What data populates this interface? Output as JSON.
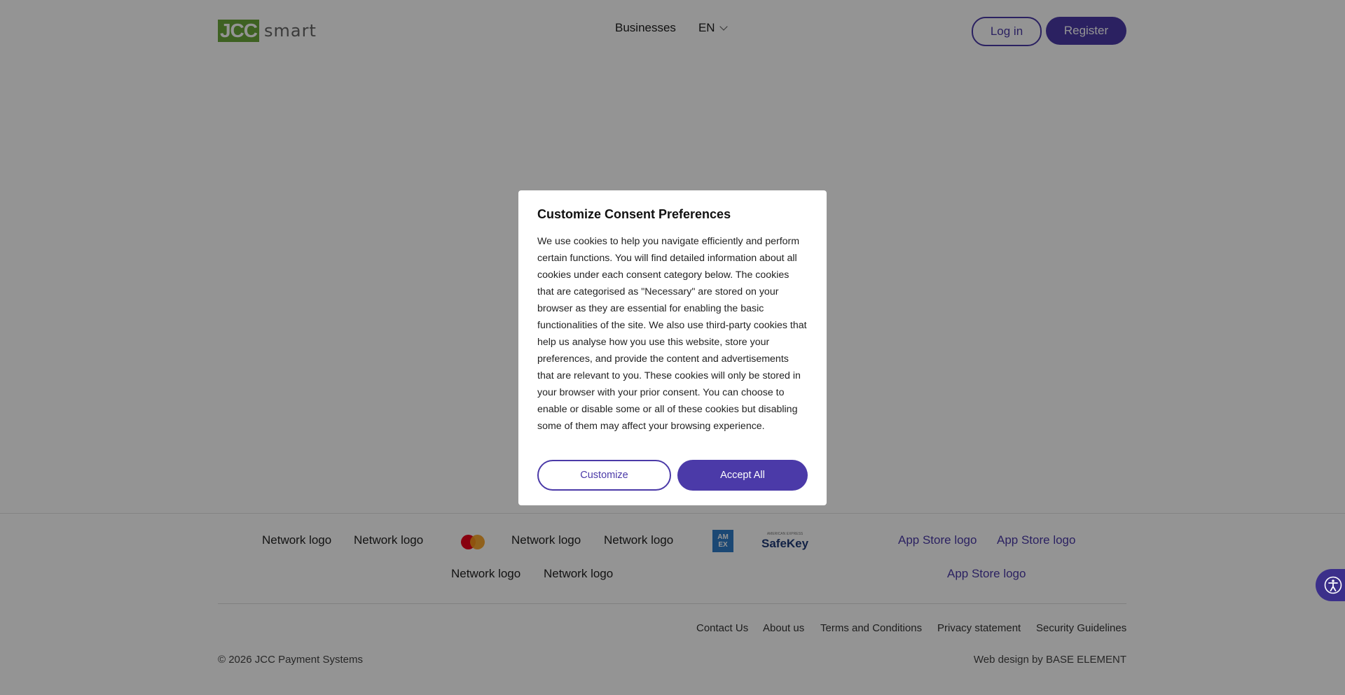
{
  "header": {
    "logo_mark": "JCC",
    "logo_word": "smart",
    "nav_businesses": "Businesses",
    "language": "EN",
    "login_label": "Log in",
    "register_label": "Register"
  },
  "footer": {
    "network_logos_row1": [
      "Network logo",
      "Network logo",
      "Network logo",
      "Network logo"
    ],
    "network_logos_row2": [
      "Network logo",
      "Network logo"
    ],
    "amex_text": "AM EX",
    "safekey_text": "SafeKey",
    "safekey_small": "AMERICAN EXPRESS",
    "app_store_logos": [
      "App Store logo",
      "App Store logo",
      "App Store logo"
    ],
    "links": [
      "Contact Us",
      "About us",
      "Terms and Conditions",
      "Privacy statement",
      "Security Guidelines"
    ],
    "copyright": "© 2026 JCC Payment Systems",
    "webdesign": "Web design by BASE ELEMENT"
  },
  "consent": {
    "title": "Customize Consent Preferences",
    "body": "We use cookies to help you navigate efficiently and perform certain functions. You will find detailed information about all cookies under each consent category below. The cookies that are categorised as \"Necessary\" are stored on your browser as they are essential for enabling the basic functionalities of the site. We also use third-party cookies that help us analyse how you use this website, store your preferences, and provide the content and advertisements that are relevant to you. These cookies will only be stored in your browser with your prior consent. You can choose to enable or disable some or all of these cookies but disabling some of them may affect your browsing experience.",
    "customize_label": "Customize",
    "accept_label": "Accept All"
  },
  "colors": {
    "accent": "#4b3aa8",
    "logo_green": "#6ca83b",
    "overlay": "rgba(0,0,0,0.42)"
  },
  "icons": {
    "language_dropdown": "chevron-down-icon",
    "accessibility": "accessibility-icon",
    "mastercard": "mastercard-logo"
  }
}
